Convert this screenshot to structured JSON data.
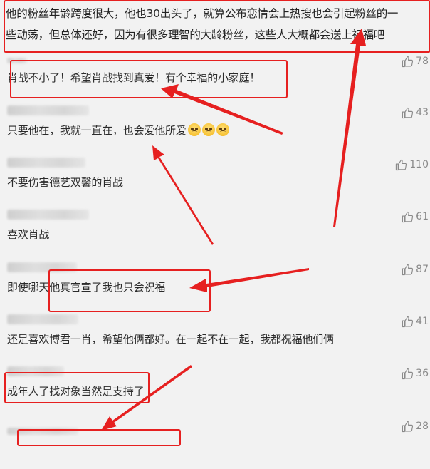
{
  "header": {
    "line1": "他的粉丝年龄跨度很大，他也30出头了，就算公布恋情会上热搜也会引起粉丝的一",
    "line2": "些动荡，但总体还好，因为有很多理智的大龄粉丝，这些人大概都会送上祝福吧"
  },
  "comments": [
    {
      "text": "肖战不小了！希望肖战找到真爱！有个幸福的小家庭！",
      "likes": "78"
    },
    {
      "text": "只要他在，我就一直在，也会爱他所爱",
      "likes": "43"
    },
    {
      "text": "不要伤害德艺双馨的肖战",
      "likes": "110"
    },
    {
      "text": "喜欢肖战",
      "likes": "61"
    },
    {
      "text": "即使哪天他真官宣了我也只会祝福",
      "likes": "87"
    },
    {
      "text": "还是喜欢博君一肖，希望他俩都好。在一起不在一起，我都祝福他们俩",
      "likes": "41"
    },
    {
      "text": "成年人了找对象当然是支持了",
      "likes": "36"
    },
    {
      "text": "",
      "likes": "28"
    }
  ],
  "icons": {
    "like": "thumbs-up-icon",
    "emoji": "pleading-face-emoji"
  },
  "colors": {
    "annotation": "#e62020",
    "background": "#f2f2f2",
    "like_text": "#8a8a8a"
  }
}
